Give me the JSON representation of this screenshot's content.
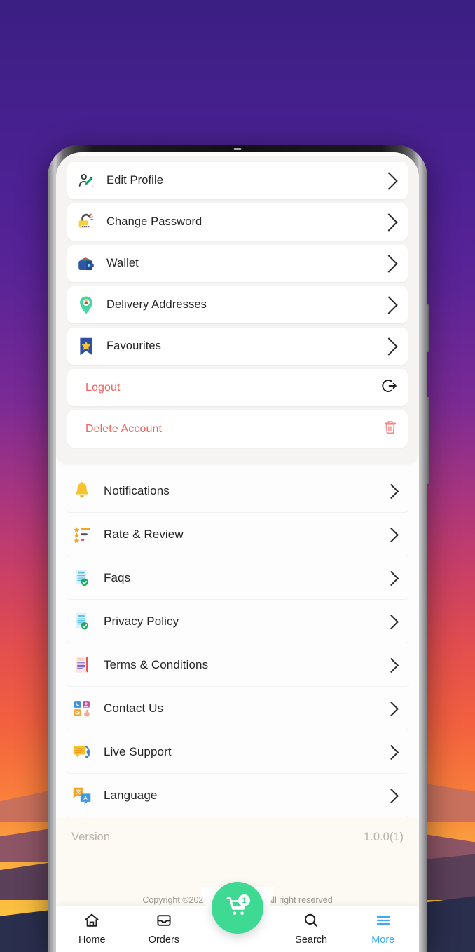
{
  "wallpaper": {
    "gradient_top": "#3b1f82",
    "gradient_bottom": "#fbc93f",
    "ridge_colors": [
      "#c9715c",
      "#8d5566",
      "#5b4059",
      "#2b2f4e"
    ]
  },
  "profile_panel": {
    "items": [
      {
        "label": "Edit Profile",
        "icon": "edit-profile-icon",
        "action": "chevron"
      },
      {
        "label": "Change Password",
        "icon": "padlock-icon",
        "action": "chevron"
      },
      {
        "label": "Wallet",
        "icon": "wallet-icon",
        "action": "chevron"
      },
      {
        "label": "Delivery Addresses",
        "icon": "location-pin-icon",
        "action": "chevron"
      },
      {
        "label": "Favourites",
        "icon": "bookmark-star-icon",
        "action": "chevron"
      },
      {
        "label": "Logout",
        "icon": "none",
        "action": "logout"
      },
      {
        "label": "Delete Account",
        "icon": "none",
        "action": "trash"
      }
    ],
    "danger_color": "#f0635e"
  },
  "menu_list": {
    "items": [
      {
        "label": "Notifications",
        "icon": "bell-icon"
      },
      {
        "label": "Rate & Review",
        "icon": "rate-review-icon"
      },
      {
        "label": "Faqs",
        "icon": "document-shield-icon"
      },
      {
        "label": "Privacy Policy",
        "icon": "document-shield-icon"
      },
      {
        "label": "Terms & Conditions",
        "icon": "terms-document-icon"
      },
      {
        "label": "Contact Us",
        "icon": "contact-grid-icon"
      },
      {
        "label": "Live Support",
        "icon": "headset-chat-icon"
      },
      {
        "label": "Language",
        "icon": "translate-icon"
      }
    ]
  },
  "version": {
    "label": "Version",
    "value": "1.0.0(1)"
  },
  "copyright": {
    "text_left": "Copyright ©2023 E",
    "text_right": "rt all right reserved"
  },
  "cart": {
    "badge_count": "1",
    "color": "#3ed992"
  },
  "bottom_nav": {
    "active_color": "#3fa9f5",
    "items": [
      {
        "label": "Home",
        "icon": "home-icon",
        "active": false
      },
      {
        "label": "Orders",
        "icon": "orders-icon",
        "active": false
      },
      {
        "label": "Search",
        "icon": "search-icon",
        "active": false
      },
      {
        "label": "More",
        "icon": "menu-icon",
        "active": true
      }
    ]
  }
}
